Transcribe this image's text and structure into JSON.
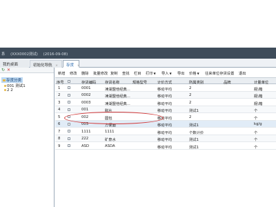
{
  "window": {
    "title_parts": [
      "系",
      "(XXX0002测试)",
      "(2016-09-08)"
    ]
  },
  "tabs": [
    {
      "label": "我的桌面"
    },
    {
      "label": "初始化导航",
      "close": "×"
    },
    {
      "label": "存货",
      "close": "×"
    }
  ],
  "left_panel": {
    "tools": [
      {
        "icon": "refresh-icon",
        "glyph": "↻",
        "color": "#2e7d32"
      },
      {
        "icon": "delete-icon",
        "glyph": "✕",
        "color": "#d32f2f"
      }
    ],
    "tree": {
      "root": "存货分类",
      "children": [
        "001 测试1",
        "2 2"
      ]
    }
  },
  "toolbar": {
    "buttons": [
      {
        "label": "新增"
      },
      {
        "label": "修改"
      },
      {
        "label": "删除"
      },
      {
        "label": "批量修改"
      },
      {
        "label": "复制"
      },
      {
        "label": "查找"
      },
      {
        "label": "栏目"
      },
      {
        "label": "打印",
        "caret": "▼"
      },
      {
        "label": "导入",
        "caret": "▼"
      },
      {
        "label": "导出"
      },
      {
        "label": "价格",
        "caret": "▼"
      },
      {
        "label": "往来单位存货设置"
      },
      {
        "label": "退出"
      }
    ]
  },
  "grid": {
    "columns": [
      "序号",
      "",
      "存货编码",
      "存货名称",
      "规格型号",
      "计价方式",
      "所属类别",
      "品牌",
      "计量单位"
    ],
    "rows": [
      {
        "no": "1",
        "code": "0001",
        "name": "凍湖盟他经典...",
        "spec": "",
        "method": "移动平均",
        "category": "2",
        "brand": "",
        "unit": "瓶\\箱"
      },
      {
        "no": "2",
        "code": "0002",
        "name": "凍湖盟他经典...",
        "spec": "",
        "method": "移动平均",
        "category": "2",
        "brand": "",
        "unit": "瓶\\箱"
      },
      {
        "no": "3",
        "code": "0003",
        "name": "凍湖盟他经典...",
        "spec": "",
        "method": "移动平均",
        "category": "2",
        "brand": "",
        "unit": "瓶\\箱"
      },
      {
        "no": "4",
        "code": "001",
        "name": "脱片",
        "spec": "",
        "method": "移动平均",
        "category": "测试1",
        "brand": "",
        "unit": "个"
      },
      {
        "no": "5",
        "code": "002",
        "name": "圆包",
        "spec": "",
        "method": "移动平均",
        "category": "2",
        "brand": "",
        "unit": "个"
      },
      {
        "no": "6",
        "code": "003",
        "name": "方便面",
        "spec": "",
        "method": "移动平均",
        "category": "测试1",
        "brand": "",
        "unit": "kg/g"
      },
      {
        "no": "7",
        "code": "1111",
        "name": "1111",
        "spec": "",
        "method": "移动平均",
        "category": "个数计价",
        "brand": "",
        "unit": "个"
      },
      {
        "no": "8",
        "code": "222",
        "name": "矿泉水",
        "spec": "",
        "method": "移动平均",
        "category": "测试1",
        "brand": "",
        "unit": "个"
      },
      {
        "no": "9",
        "code": "ASD",
        "name": "ASDA",
        "spec": "",
        "method": "移动平均",
        "category": "测试1",
        "brand": "",
        "unit": "个"
      }
    ]
  },
  "colors": {
    "topbar": "#3e4c5a",
    "selection": "#bcd8f2",
    "annotation": "#d23a3a"
  }
}
